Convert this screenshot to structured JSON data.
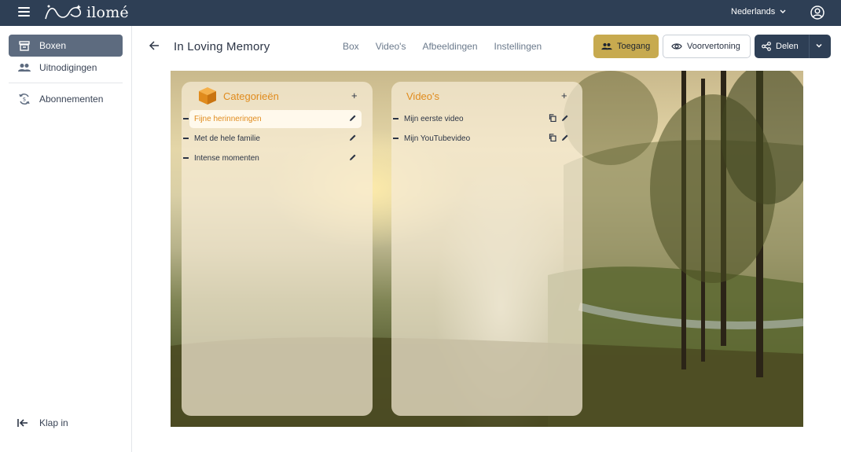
{
  "app": {
    "brand_name": "ilomé",
    "language": "Nederlands",
    "colors": {
      "topbar": "#2e3f55",
      "accent_gold": "#c7aa4f",
      "accent_orange": "#e08b1d"
    }
  },
  "sidebar": {
    "items": [
      {
        "label": "Boxen",
        "icon": "archive-icon",
        "active": true
      },
      {
        "label": "Uitnodigingen",
        "icon": "people-icon",
        "active": false
      },
      {
        "label": "Abonnementen",
        "icon": "subscription-icon",
        "active": false
      }
    ],
    "collapse_label": "Klap in"
  },
  "header": {
    "title": "In Loving Memory",
    "tabs": [
      "Box",
      "Video's",
      "Afbeeldingen",
      "Instellingen"
    ],
    "access_label": "Toegang",
    "preview_label": "Voorvertoning",
    "share_label": "Delen"
  },
  "categories_panel": {
    "title": "Categorieën",
    "add": "+",
    "items": [
      {
        "label": "Fijne herinneringen",
        "active": true
      },
      {
        "label": "Met de hele familie",
        "active": false
      },
      {
        "label": "Intense momenten",
        "active": false
      }
    ]
  },
  "videos_panel": {
    "title": "Video's",
    "add": "+",
    "items": [
      {
        "label": "Mijn eerste video"
      },
      {
        "label": "Mijn YouTubevideo"
      }
    ]
  }
}
